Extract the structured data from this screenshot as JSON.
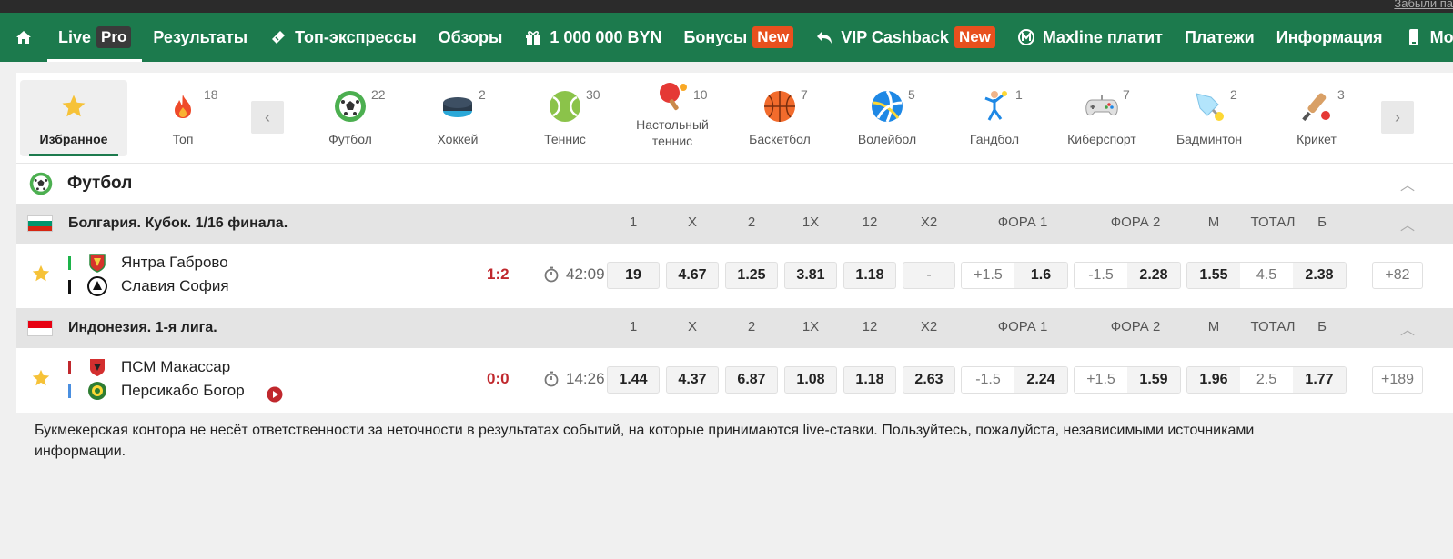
{
  "top": {
    "forgot": "Забыли па"
  },
  "nav": {
    "live": "Live",
    "pro": "Pro",
    "results": "Результаты",
    "top_express": "Топ-экспрессы",
    "reviews": "Обзоры",
    "million": "1 000 000 BYN",
    "bonuses": "Бонусы",
    "new1": "New",
    "vip": "VIP Cashback",
    "new2": "New",
    "maxline": "Maxline платит",
    "payments": "Платежи",
    "info": "Информация",
    "mobile": "Mobile"
  },
  "sports": [
    {
      "label": "Избранное",
      "count": ""
    },
    {
      "label": "Топ",
      "count": "18"
    },
    {
      "label": "Футбол",
      "count": "22"
    },
    {
      "label": "Хоккей",
      "count": "2"
    },
    {
      "label": "Теннис",
      "count": "30"
    },
    {
      "label": "Настольный теннис",
      "count": "10"
    },
    {
      "label": "Баскетбол",
      "count": "7"
    },
    {
      "label": "Волейбол",
      "count": "5"
    },
    {
      "label": "Гандбол",
      "count": "1"
    },
    {
      "label": "Киберспорт",
      "count": "7"
    },
    {
      "label": "Бадминтон",
      "count": "2"
    },
    {
      "label": "Крикет",
      "count": "3"
    }
  ],
  "section": {
    "title": "Футбол"
  },
  "columns": [
    "1",
    "X",
    "2",
    "1X",
    "12",
    "X2",
    "ФОРА 1",
    "ФОРА 2",
    "М",
    "ТОТАЛ",
    "Б"
  ],
  "leagues": [
    {
      "name": "Болгария. Кубок. 1/16 финала.",
      "match": {
        "team1": "Янтра Габрово",
        "team2": "Славия София",
        "score": "1:2",
        "time": "42:09",
        "o1": "19",
        "ox": "4.67",
        "o2": "1.25",
        "o1x": "3.81",
        "o12": "1.18",
        "ox2": "-",
        "f1h": "+1.5",
        "f1": "1.6",
        "f2h": "-1.5",
        "f2": "2.28",
        "m": "1.55",
        "total": "4.5",
        "b": "2.38",
        "more": "+82"
      }
    },
    {
      "name": "Индонезия. 1-я лига.",
      "match": {
        "team1": "ПСМ Макассар",
        "team2": "Персикабо Богор",
        "score": "0:0",
        "time": "14:26",
        "o1": "1.44",
        "ox": "4.37",
        "o2": "6.87",
        "o1x": "1.08",
        "o12": "1.18",
        "ox2": "2.63",
        "f1h": "-1.5",
        "f1": "2.24",
        "f2h": "+1.5",
        "f2": "1.59",
        "m": "1.96",
        "total": "2.5",
        "b": "1.77",
        "more": "+189"
      }
    }
  ],
  "disclaimer": "Букмекерская контора не несёт ответственности за неточности в результатах событий, на которые принимаются live-ставки. Пользуйтесь, пожалуйста, независимыми источниками информации.",
  "colors": {
    "brand": "#1c7a4d",
    "new": "#e8501e",
    "score": "#c0282d"
  }
}
